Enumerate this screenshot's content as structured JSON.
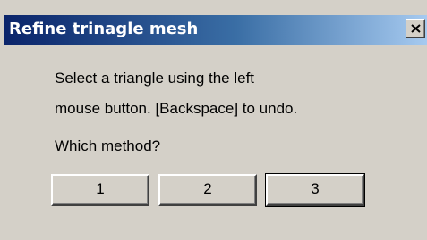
{
  "window": {
    "title": "Refine trinagle mesh",
    "close_icon": "close-icon"
  },
  "message": {
    "line1": "Select a triangle using the left",
    "line2": "mouse button. [Backspace] to undo.",
    "prompt": "Which method?"
  },
  "buttons": [
    {
      "label": "1"
    },
    {
      "label": "2"
    },
    {
      "label": "3",
      "default": true
    }
  ],
  "colors": {
    "titlebar_start": "#0a246a",
    "titlebar_end": "#a6caf0",
    "face": "#d4d0c8"
  }
}
